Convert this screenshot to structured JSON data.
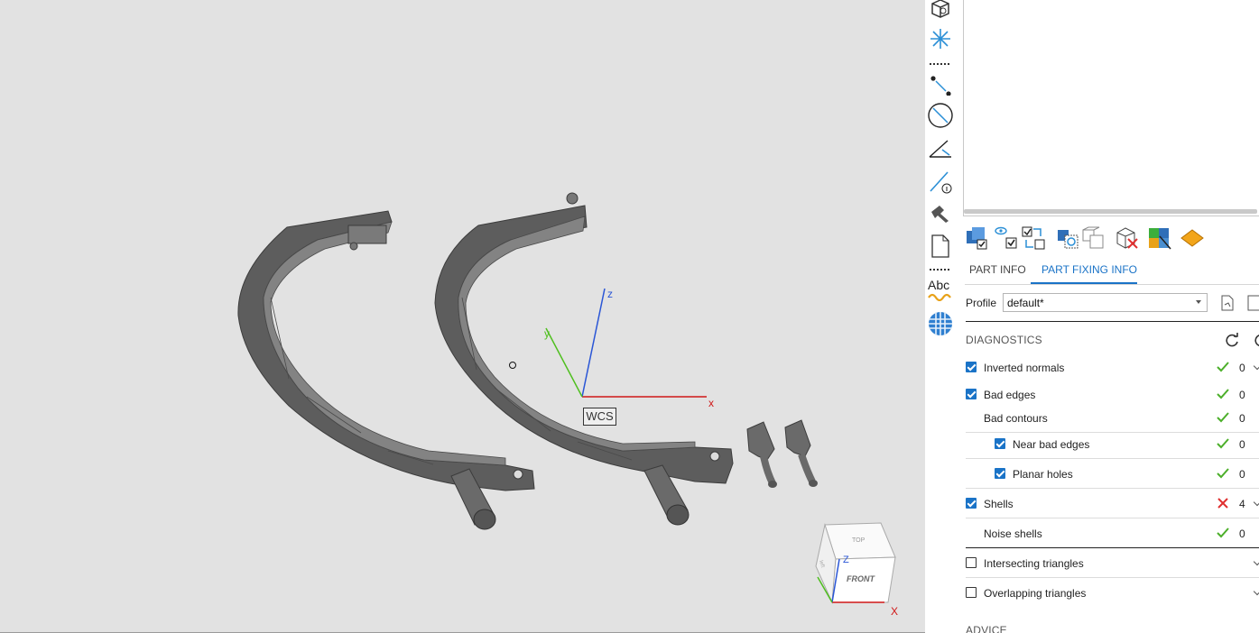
{
  "viewport": {
    "wcs_label": "WCS",
    "axis_labels": {
      "x": "x",
      "y": "y",
      "z": "z"
    },
    "viewcube": {
      "top": "TOP",
      "front": "FRONT",
      "left": "left",
      "z": "Z",
      "x": "X"
    },
    "background": "#e2e2e2",
    "part_color": "#6b6b6b"
  },
  "toolstrip": {
    "items": [
      {
        "name": "view-box-icon"
      },
      {
        "name": "snowflake-icon"
      },
      {
        "name": "measure-points-icon"
      },
      {
        "name": "measure-diameter-icon"
      },
      {
        "name": "measure-angle-icon"
      },
      {
        "name": "measure-info-icon"
      },
      {
        "name": "hammer-icon"
      },
      {
        "name": "document-icon"
      },
      {
        "name": "text-label-icon",
        "text": "Abc"
      },
      {
        "name": "texture-sphere-icon"
      }
    ]
  },
  "panel": {
    "tabs": [
      {
        "label": "PART INFO",
        "active": false
      },
      {
        "label": "PART FIXING INFO",
        "active": true
      }
    ],
    "profile": {
      "label": "Profile",
      "value": "default*"
    },
    "diagnostics": {
      "title": "DIAGNOSTICS",
      "rows": [
        {
          "label": "Inverted normals",
          "checkbox": true,
          "checked": true,
          "status": "ok",
          "count": "0",
          "indent": 0,
          "expandable": true
        },
        {
          "label": "Bad edges",
          "checkbox": true,
          "checked": true,
          "status": "ok",
          "count": "0",
          "indent": 0,
          "expandable": false
        },
        {
          "label": "Bad contours",
          "checkbox": false,
          "checked": false,
          "status": "ok",
          "count": "0",
          "indent": 1,
          "expandable": false
        },
        {
          "label": "Near bad edges",
          "checkbox": true,
          "checked": true,
          "status": "ok",
          "count": "0",
          "indent": 1,
          "expandable": false
        },
        {
          "label": "Planar holes",
          "checkbox": true,
          "checked": true,
          "status": "ok",
          "count": "0",
          "indent": 1,
          "expandable": false
        },
        {
          "label": "Shells",
          "checkbox": true,
          "checked": true,
          "status": "error",
          "count": "4",
          "indent": 0,
          "expandable": true
        },
        {
          "label": "Noise shells",
          "checkbox": false,
          "checked": false,
          "status": "ok",
          "count": "0",
          "indent": 1,
          "expandable": false
        },
        {
          "label": "Intersecting triangles",
          "checkbox": true,
          "checked": false,
          "status": "",
          "count": "",
          "indent": 0,
          "expandable": true
        },
        {
          "label": "Overlapping triangles",
          "checkbox": true,
          "checked": false,
          "status": "",
          "count": "",
          "indent": 0,
          "expandable": true
        }
      ]
    },
    "advice_title": "ADVICE",
    "colors": {
      "accent": "#1a73c7",
      "ok": "#4caf2a",
      "error": "#e03030"
    }
  }
}
